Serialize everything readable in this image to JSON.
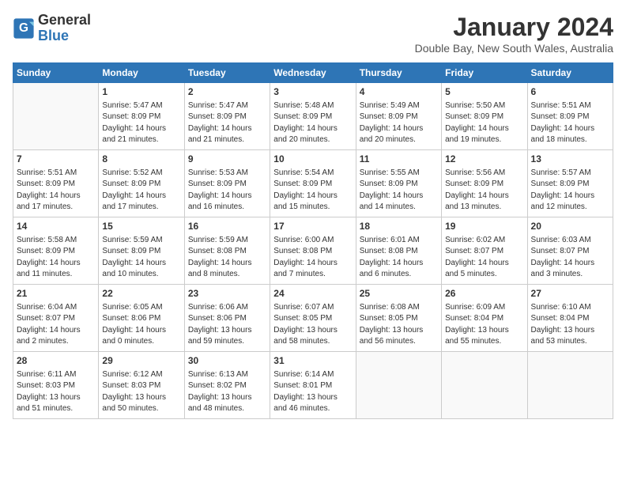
{
  "header": {
    "logo_line1": "General",
    "logo_line2": "Blue",
    "month_year": "January 2024",
    "location": "Double Bay, New South Wales, Australia"
  },
  "days_of_week": [
    "Sunday",
    "Monday",
    "Tuesday",
    "Wednesday",
    "Thursday",
    "Friday",
    "Saturday"
  ],
  "weeks": [
    [
      {
        "day": "",
        "info": ""
      },
      {
        "day": "1",
        "info": "Sunrise: 5:47 AM\nSunset: 8:09 PM\nDaylight: 14 hours\nand 21 minutes."
      },
      {
        "day": "2",
        "info": "Sunrise: 5:47 AM\nSunset: 8:09 PM\nDaylight: 14 hours\nand 21 minutes."
      },
      {
        "day": "3",
        "info": "Sunrise: 5:48 AM\nSunset: 8:09 PM\nDaylight: 14 hours\nand 20 minutes."
      },
      {
        "day": "4",
        "info": "Sunrise: 5:49 AM\nSunset: 8:09 PM\nDaylight: 14 hours\nand 20 minutes."
      },
      {
        "day": "5",
        "info": "Sunrise: 5:50 AM\nSunset: 8:09 PM\nDaylight: 14 hours\nand 19 minutes."
      },
      {
        "day": "6",
        "info": "Sunrise: 5:51 AM\nSunset: 8:09 PM\nDaylight: 14 hours\nand 18 minutes."
      }
    ],
    [
      {
        "day": "7",
        "info": "Sunrise: 5:51 AM\nSunset: 8:09 PM\nDaylight: 14 hours\nand 17 minutes."
      },
      {
        "day": "8",
        "info": "Sunrise: 5:52 AM\nSunset: 8:09 PM\nDaylight: 14 hours\nand 17 minutes."
      },
      {
        "day": "9",
        "info": "Sunrise: 5:53 AM\nSunset: 8:09 PM\nDaylight: 14 hours\nand 16 minutes."
      },
      {
        "day": "10",
        "info": "Sunrise: 5:54 AM\nSunset: 8:09 PM\nDaylight: 14 hours\nand 15 minutes."
      },
      {
        "day": "11",
        "info": "Sunrise: 5:55 AM\nSunset: 8:09 PM\nDaylight: 14 hours\nand 14 minutes."
      },
      {
        "day": "12",
        "info": "Sunrise: 5:56 AM\nSunset: 8:09 PM\nDaylight: 14 hours\nand 13 minutes."
      },
      {
        "day": "13",
        "info": "Sunrise: 5:57 AM\nSunset: 8:09 PM\nDaylight: 14 hours\nand 12 minutes."
      }
    ],
    [
      {
        "day": "14",
        "info": "Sunrise: 5:58 AM\nSunset: 8:09 PM\nDaylight: 14 hours\nand 11 minutes."
      },
      {
        "day": "15",
        "info": "Sunrise: 5:59 AM\nSunset: 8:09 PM\nDaylight: 14 hours\nand 10 minutes."
      },
      {
        "day": "16",
        "info": "Sunrise: 5:59 AM\nSunset: 8:08 PM\nDaylight: 14 hours\nand 8 minutes."
      },
      {
        "day": "17",
        "info": "Sunrise: 6:00 AM\nSunset: 8:08 PM\nDaylight: 14 hours\nand 7 minutes."
      },
      {
        "day": "18",
        "info": "Sunrise: 6:01 AM\nSunset: 8:08 PM\nDaylight: 14 hours\nand 6 minutes."
      },
      {
        "day": "19",
        "info": "Sunrise: 6:02 AM\nSunset: 8:07 PM\nDaylight: 14 hours\nand 5 minutes."
      },
      {
        "day": "20",
        "info": "Sunrise: 6:03 AM\nSunset: 8:07 PM\nDaylight: 14 hours\nand 3 minutes."
      }
    ],
    [
      {
        "day": "21",
        "info": "Sunrise: 6:04 AM\nSunset: 8:07 PM\nDaylight: 14 hours\nand 2 minutes."
      },
      {
        "day": "22",
        "info": "Sunrise: 6:05 AM\nSunset: 8:06 PM\nDaylight: 14 hours\nand 0 minutes."
      },
      {
        "day": "23",
        "info": "Sunrise: 6:06 AM\nSunset: 8:06 PM\nDaylight: 13 hours\nand 59 minutes."
      },
      {
        "day": "24",
        "info": "Sunrise: 6:07 AM\nSunset: 8:05 PM\nDaylight: 13 hours\nand 58 minutes."
      },
      {
        "day": "25",
        "info": "Sunrise: 6:08 AM\nSunset: 8:05 PM\nDaylight: 13 hours\nand 56 minutes."
      },
      {
        "day": "26",
        "info": "Sunrise: 6:09 AM\nSunset: 8:04 PM\nDaylight: 13 hours\nand 55 minutes."
      },
      {
        "day": "27",
        "info": "Sunrise: 6:10 AM\nSunset: 8:04 PM\nDaylight: 13 hours\nand 53 minutes."
      }
    ],
    [
      {
        "day": "28",
        "info": "Sunrise: 6:11 AM\nSunset: 8:03 PM\nDaylight: 13 hours\nand 51 minutes."
      },
      {
        "day": "29",
        "info": "Sunrise: 6:12 AM\nSunset: 8:03 PM\nDaylight: 13 hours\nand 50 minutes."
      },
      {
        "day": "30",
        "info": "Sunrise: 6:13 AM\nSunset: 8:02 PM\nDaylight: 13 hours\nand 48 minutes."
      },
      {
        "day": "31",
        "info": "Sunrise: 6:14 AM\nSunset: 8:01 PM\nDaylight: 13 hours\nand 46 minutes."
      },
      {
        "day": "",
        "info": ""
      },
      {
        "day": "",
        "info": ""
      },
      {
        "day": "",
        "info": ""
      }
    ]
  ]
}
